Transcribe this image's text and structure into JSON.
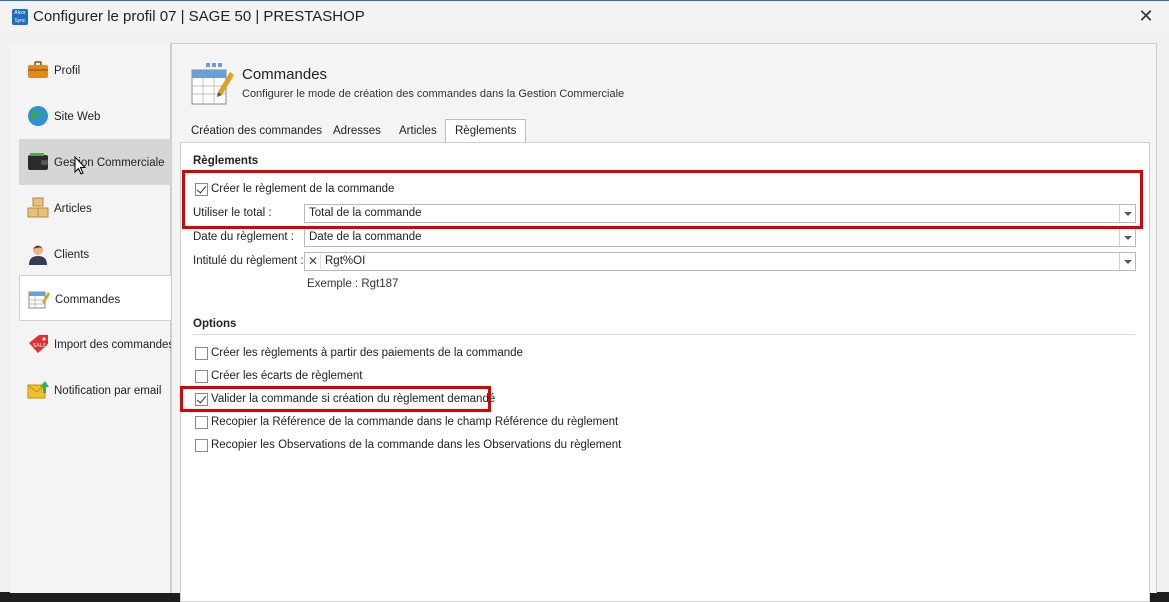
{
  "window": {
    "app_logo_text": "Alcor Sync",
    "title": "Configurer le profil 07 | SAGE 50 | PRESTASHOP",
    "close_glyph": "✕"
  },
  "sidebar": {
    "items": [
      {
        "label": "Profil",
        "icon": "briefcase-icon",
        "state": "normal"
      },
      {
        "label": "Site Web",
        "icon": "globe-icon",
        "state": "normal"
      },
      {
        "label": "Gestion Commerciale",
        "icon": "wallet-icon",
        "state": "hover"
      },
      {
        "label": "Articles",
        "icon": "boxes-icon",
        "state": "normal"
      },
      {
        "label": "Clients",
        "icon": "person-icon",
        "state": "normal"
      },
      {
        "label": "Commandes",
        "icon": "order-sheet-icon",
        "state": "active"
      },
      {
        "label": "Import des commandes",
        "icon": "sale-tag-icon",
        "state": "normal"
      },
      {
        "label": "Notification par email",
        "icon": "email-arrow-icon",
        "state": "normal"
      }
    ]
  },
  "header": {
    "title": "Commandes",
    "subtitle": "Configurer le mode de création des commandes dans la Gestion Commerciale",
    "icon": "order-sheet-icon"
  },
  "tabs": [
    {
      "label": "Création des commandes",
      "active": false
    },
    {
      "label": "Adresses",
      "active": false
    },
    {
      "label": "Articles",
      "active": false
    },
    {
      "label": "Règlements",
      "active": true
    }
  ],
  "reglements": {
    "section_title": "Règlements",
    "create_checkbox": {
      "label": "Créer le règlement de la commande",
      "checked": true
    },
    "total": {
      "label": "Utiliser le total :",
      "value": "Total de la commande"
    },
    "date": {
      "label": "Date du règlement :",
      "value": "Date de la commande"
    },
    "intitule": {
      "label": "Intitulé du règlement :",
      "value": "Rgt%OI",
      "clear_glyph": "✕"
    },
    "example": "Exemple : Rgt187"
  },
  "options": {
    "section_title": "Options",
    "items": [
      {
        "label": "Créer les règlements à partir des paiements de la commande",
        "checked": false
      },
      {
        "label": "Créer les écarts de règlement",
        "checked": false
      },
      {
        "label": "Valider la commande si création du règlement demandé",
        "checked": true
      },
      {
        "label": "Recopier la Référence de la commande dans le champ Référence du règlement",
        "checked": false
      },
      {
        "label": "Recopier les Observations de la commande dans les Observations du règlement",
        "checked": false
      }
    ]
  },
  "colors": {
    "highlight_red": "#e00000",
    "window_accent": "#2d6fb8"
  }
}
